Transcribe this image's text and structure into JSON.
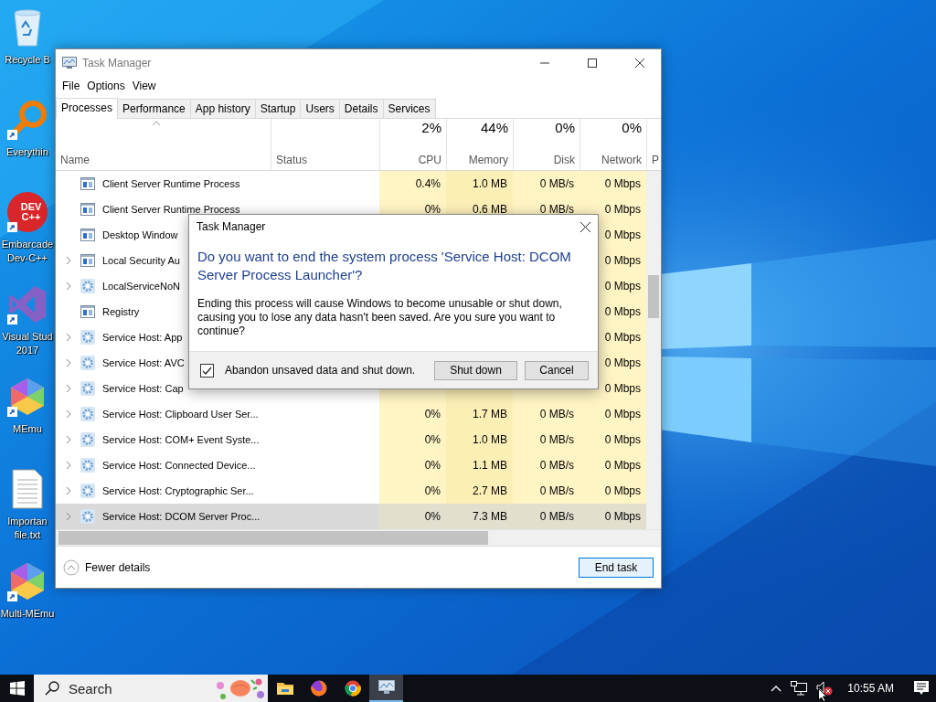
{
  "desktop": {
    "icons": [
      {
        "label": "Recycle B",
        "kind": "recycle-bin",
        "shortcut": false
      },
      {
        "label": "Everythin",
        "kind": "everything",
        "shortcut": true
      },
      {
        "label": "Embarcade\nDev-C++",
        "kind": "devcpp",
        "logo_text": "DEV\nC++",
        "shortcut": true
      },
      {
        "label": "Visual Stud\n2017",
        "kind": "visual-studio",
        "shortcut": true
      },
      {
        "label": "MEmu",
        "kind": "memu",
        "shortcut": true
      },
      {
        "label": "Importan\nfile.txt",
        "kind": "text-file",
        "shortcut": false
      },
      {
        "label": "Multi-MEmu",
        "kind": "memu",
        "shortcut": true
      }
    ]
  },
  "task_manager": {
    "title": "Task Manager",
    "menu": [
      "File",
      "Options",
      "View"
    ],
    "tabs": [
      {
        "label": "Processes",
        "selected": true
      },
      {
        "label": "Performance",
        "selected": false
      },
      {
        "label": "App history",
        "selected": false
      },
      {
        "label": "Startup",
        "selected": false
      },
      {
        "label": "Users",
        "selected": false
      },
      {
        "label": "Details",
        "selected": false
      },
      {
        "label": "Services",
        "selected": false
      }
    ],
    "columns": [
      {
        "label": "Name",
        "sorted": true
      },
      {
        "label": "Status",
        "sorted": false
      },
      {
        "label": "CPU",
        "usage": "2%",
        "sorted": false
      },
      {
        "label": "Memory",
        "usage": "44%",
        "sorted": false
      },
      {
        "label": "Disk",
        "usage": "0%",
        "sorted": false
      },
      {
        "label": "Network",
        "usage": "0%",
        "sorted": false
      },
      {
        "label": "P",
        "sorted": false
      }
    ],
    "rows": [
      {
        "name": "Client Server Runtime Process",
        "kind": "window",
        "expandable": false,
        "selected": false,
        "cpu": "0.4%",
        "memory": "1.0 MB",
        "disk": "0 MB/s",
        "network": "0 Mbps"
      },
      {
        "name": "Client Server Runtime Process",
        "kind": "window",
        "expandable": false,
        "selected": false,
        "cpu": "0%",
        "memory": "0.6 MB",
        "disk": "0 MB/s",
        "network": "0 Mbps"
      },
      {
        "name": "Desktop Window",
        "kind": "window",
        "expandable": false,
        "selected": false,
        "network": "0 Mbps"
      },
      {
        "name": "Local Security Au",
        "kind": "window",
        "expandable": true,
        "selected": false,
        "network": "0 Mbps"
      },
      {
        "name": "LocalServiceNoN",
        "kind": "service",
        "expandable": true,
        "selected": false,
        "network": "0 Mbps"
      },
      {
        "name": "Registry",
        "kind": "window",
        "expandable": false,
        "selected": false,
        "network": "0 Mbps"
      },
      {
        "name": "Service Host: App",
        "kind": "service",
        "expandable": true,
        "selected": false,
        "network": "0 Mbps"
      },
      {
        "name": "Service Host: AVC",
        "kind": "service",
        "expandable": true,
        "selected": false,
        "network": "0 Mbps"
      },
      {
        "name": "Service Host: Cap",
        "kind": "service",
        "expandable": true,
        "selected": false,
        "network": "0 Mbps"
      },
      {
        "name": "Service Host: Clipboard User Ser...",
        "kind": "service",
        "expandable": true,
        "selected": false,
        "cpu": "0%",
        "memory": "1.7 MB",
        "disk": "0 MB/s",
        "network": "0 Mbps"
      },
      {
        "name": "Service Host: COM+ Event Syste...",
        "kind": "service",
        "expandable": true,
        "selected": false,
        "cpu": "0%",
        "memory": "1.0 MB",
        "disk": "0 MB/s",
        "network": "0 Mbps"
      },
      {
        "name": "Service Host: Connected Device...",
        "kind": "service",
        "expandable": true,
        "selected": false,
        "cpu": "0%",
        "memory": "1.1 MB",
        "disk": "0 MB/s",
        "network": "0 Mbps"
      },
      {
        "name": "Service Host: Cryptographic Ser...",
        "kind": "service",
        "expandable": true,
        "selected": false,
        "cpu": "0%",
        "memory": "2.7 MB",
        "disk": "0 MB/s",
        "network": "0 Mbps"
      },
      {
        "name": "Service Host: DCOM Server Proc...",
        "kind": "service",
        "expandable": true,
        "selected": true,
        "cpu": "0%",
        "memory": "7.3 MB",
        "disk": "0 MB/s",
        "network": "0 Mbps"
      }
    ],
    "footer": {
      "toggle": "Fewer details",
      "button": "End task"
    }
  },
  "dialog": {
    "title": "Task Manager",
    "heading": "Do you want to end the system process 'Service Host: DCOM Server Process Launcher'?",
    "message": "Ending this process will cause Windows to become unusable or shut down, causing you to lose any data hasn't been saved. Are you sure you want to continue?",
    "checkbox": {
      "label": "Abandon unsaved data and shut down.",
      "checked": true
    },
    "buttons": [
      "Shut down",
      "Cancel"
    ]
  },
  "taskbar": {
    "search": {
      "placeholder": "Search"
    },
    "apps": [
      {
        "kind": "folder",
        "selected": false
      },
      {
        "kind": "firefox",
        "selected": false
      },
      {
        "kind": "chrome",
        "selected": false
      },
      {
        "kind": "task-manager",
        "selected": true
      }
    ],
    "time": "10:55 AM"
  }
}
